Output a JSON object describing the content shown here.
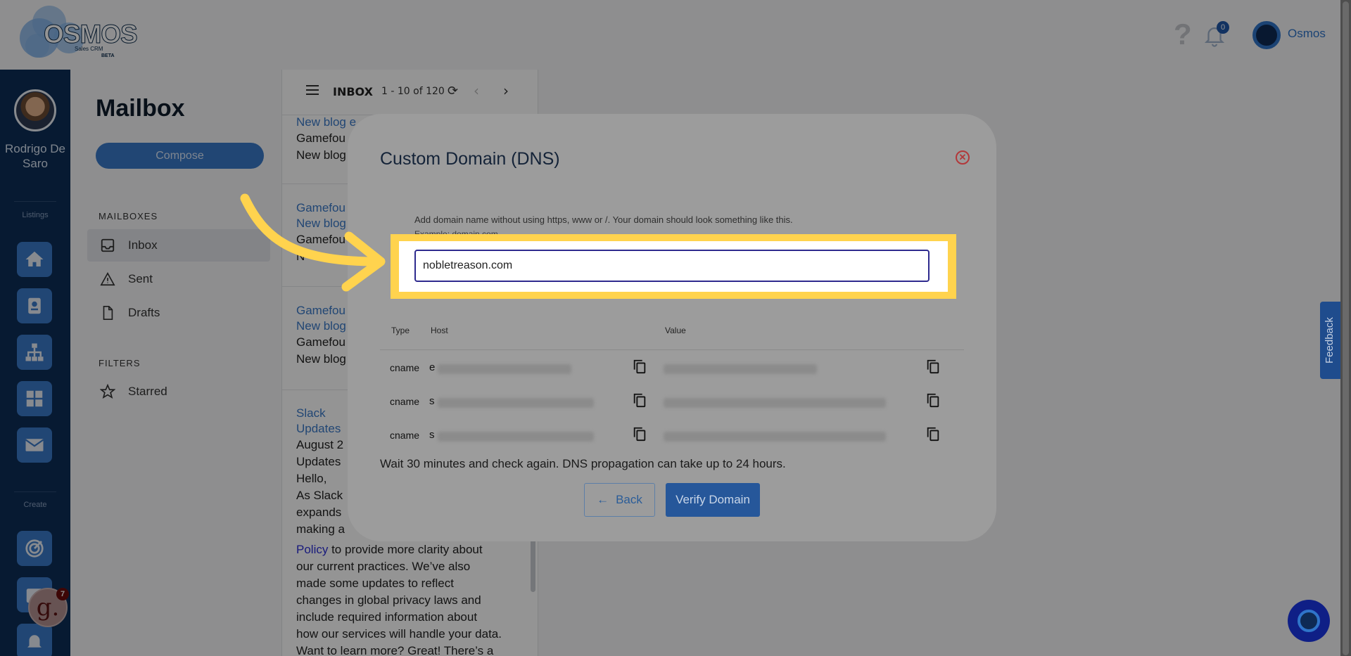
{
  "header": {
    "logo_text": "OSMOS",
    "logo_sub": "Sales CRM",
    "logo_beta": "BETA",
    "help_glyph": "?",
    "notifications_count": "0",
    "user_name": "Osmos"
  },
  "rail": {
    "user_name": "Rodrigo De Saro",
    "listings_label": "Listings",
    "create_label": "Create",
    "icons": [
      "home-icon",
      "contact-card-icon",
      "org-chart-icon",
      "dashboard-grid-icon",
      "mail-icon",
      "target-icon",
      "calendar-icon",
      "bell-icon"
    ]
  },
  "mailbox": {
    "title": "Mailbox",
    "compose_label": "Compose",
    "mailboxes_heading": "MAILBOXES",
    "items": [
      {
        "label": "Inbox",
        "icon": "inbox-icon"
      },
      {
        "label": "Sent",
        "icon": "sent-icon"
      },
      {
        "label": "Drafts",
        "icon": "drafts-icon"
      }
    ],
    "filters_heading": "FILTERS",
    "filters": [
      {
        "label": "Starred",
        "icon": "star-icon"
      }
    ]
  },
  "maillist": {
    "folder": "INBOX",
    "range": "1 - 10 of 120",
    "emails": [
      {
        "subject": "New blog e",
        "lines": [
          "Gamefou",
          "New blog"
        ]
      },
      {
        "subject": "Gamefou",
        "subject2": "New blog",
        "lines": [
          "Gamefou",
          "N"
        ]
      },
      {
        "subject": "Gamefou",
        "subject2": "New blog",
        "lines": [
          "Gamefou",
          "New blog"
        ]
      },
      {
        "subject": "Slack",
        "subject2": "Updates",
        "lines": [
          "August 2",
          "Updates",
          "Hello,",
          "As Slack",
          "expands",
          "making a"
        ]
      }
    ],
    "body_link": "Policy",
    "body_after_link": " to provide more clarity about",
    "body_rest": [
      "our current practices. We’ve also",
      "made some updates to reflect",
      "changes in global privacy laws and",
      "include required information about",
      "how our services will handle your data.",
      "Want to learn more? Great! There’s a"
    ]
  },
  "modal": {
    "title": "Custom Domain (DNS)",
    "close_glyph": "✕",
    "hint": "Add domain name without using https, www or /. Your domain should look something like this.",
    "hint_example": "Example: domain.com",
    "domain_value": "nobletreason.com",
    "table_headers": {
      "type": "Type",
      "host": "Host",
      "value": "Value"
    },
    "records": [
      {
        "type": "cname",
        "host_prefix": "e"
      },
      {
        "type": "cname",
        "host_prefix": "s"
      },
      {
        "type": "cname",
        "host_prefix": "s"
      }
    ],
    "note": "Wait 30 minutes and check again. DNS propagation can take up to 24 hours.",
    "back_label": "Back",
    "verify_label": "Verify Domain"
  },
  "feedback_label": "Feedback",
  "g_widget": {
    "letter": "g.",
    "badge": "7"
  },
  "colors": {
    "accent": "#3a79c8",
    "highlight": "#ffd34e",
    "nav": "#0d2d57"
  }
}
